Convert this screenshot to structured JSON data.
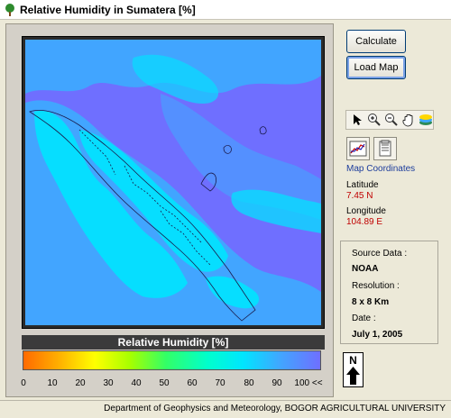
{
  "window": {
    "title": "Relative Humidity in Sumatera [%]",
    "icon": "tree-icon"
  },
  "buttons": {
    "calculate": "Calculate",
    "load_map": "Load Map"
  },
  "toolbar": {
    "tools": [
      "pointer-icon",
      "zoom-in-icon",
      "zoom-out-icon",
      "pan-hand-icon",
      "layers-icon"
    ]
  },
  "map": {
    "title": "Relative Humidity [%]",
    "colorbar_ticks": [
      "0",
      "10",
      "20",
      "30",
      "40",
      "50",
      "60",
      "70",
      "80",
      "90",
      "100 <<"
    ],
    "colors": {
      "sea": "#6f6fff",
      "high": "#3fa8ff",
      "mid": "#00e5ff"
    }
  },
  "coordinates": {
    "header": "Map Coordinates",
    "latitude_label": "Latitude",
    "latitude_value": "7.45 N",
    "longitude_label": "Longitude",
    "longitude_value": "104.89 E"
  },
  "info": {
    "source_label": "Source Data :",
    "source_value": "NOAA",
    "resolution_label": "Resolution :",
    "resolution_value": "8 x 8 Km",
    "date_label": "Date :",
    "date_value": "July 1, 2005"
  },
  "north_arrow": {
    "letter": "N"
  },
  "footer": {
    "text": "Department of Geophysics and Meteorology, BOGOR AGRICULTURAL UNIVERSITY"
  }
}
